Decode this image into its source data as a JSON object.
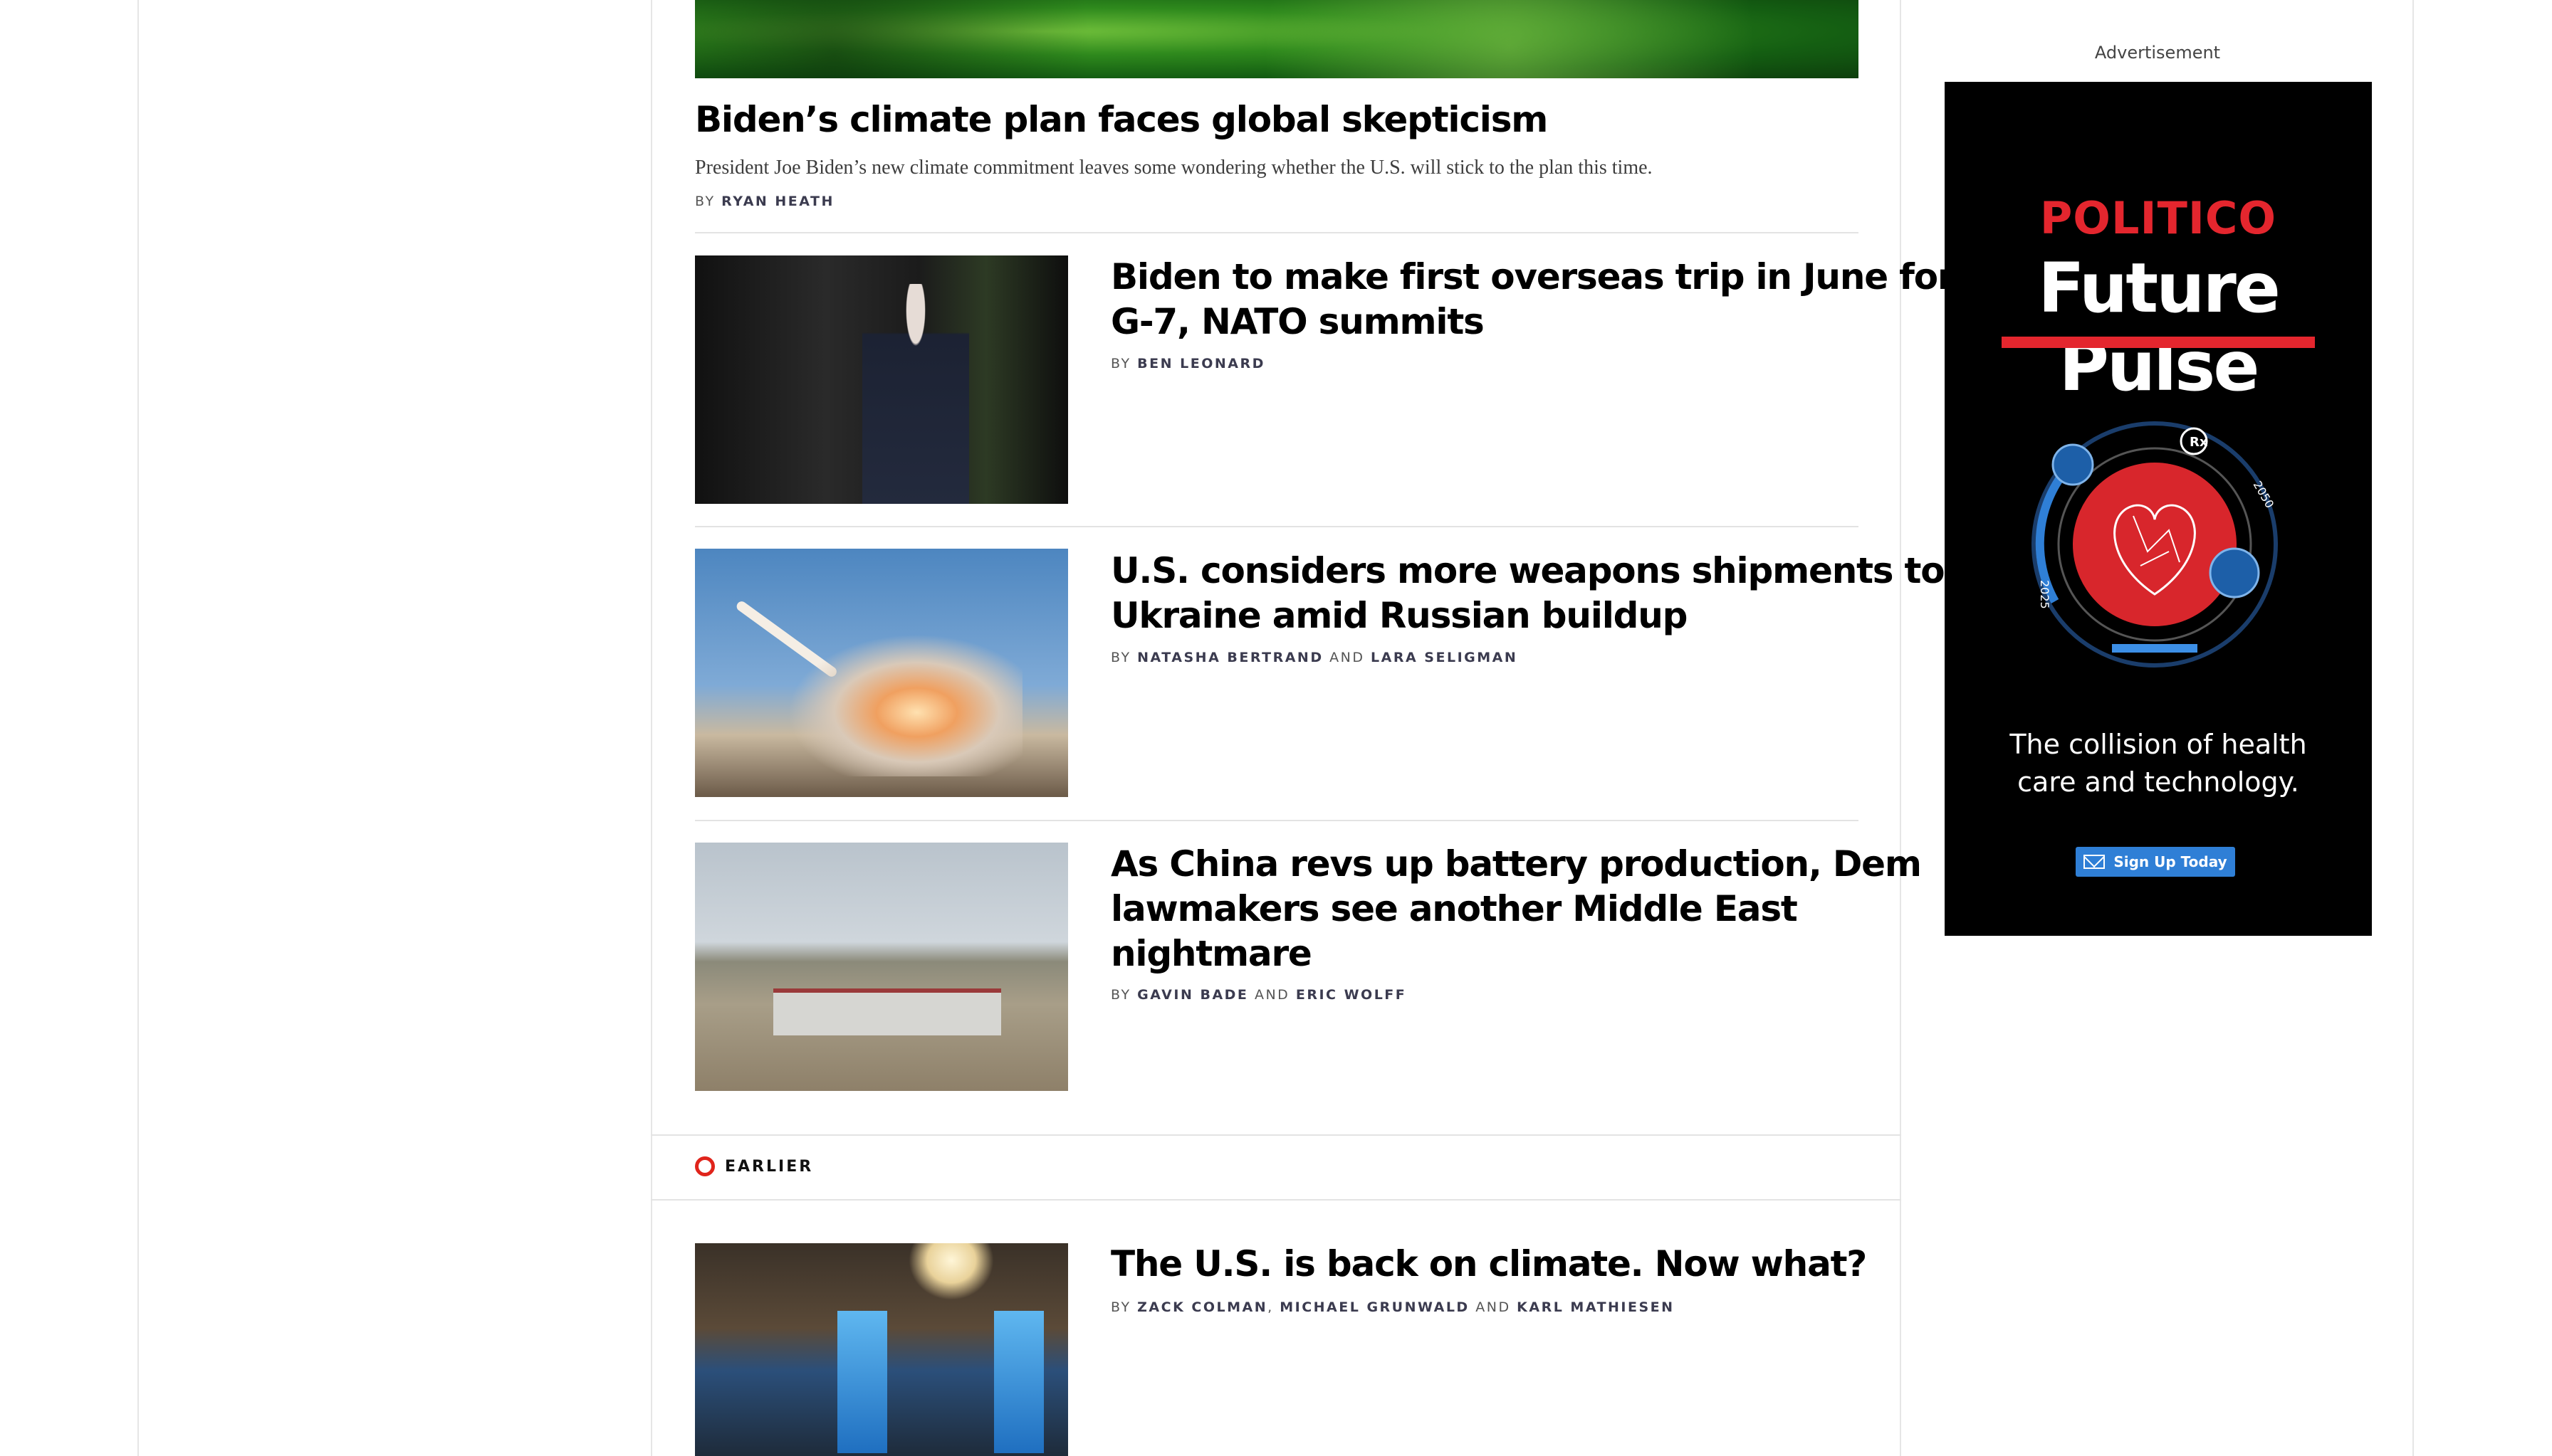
{
  "articles": [
    {
      "headline": "Biden’s climate plan faces global skepticism",
      "dek": "President Joe Biden’s new climate commitment leaves some wondering whether the U.S. will stick to the plan this time.",
      "byline_prefix": "By",
      "authors": [
        "Ryan Heath"
      ]
    },
    {
      "headline_lines": [
        "Biden to make first overseas trip in June for",
        "G-7, NATO summits"
      ],
      "byline_prefix": "By",
      "authors": [
        "Ben Leonard"
      ]
    },
    {
      "headline_lines": [
        "U.S. considers more weapons shipments to",
        "Ukraine amid Russian buildup"
      ],
      "byline_prefix": "By",
      "authors": [
        "Natasha Bertrand",
        "Lara Seligman"
      ],
      "conjunction": "and"
    },
    {
      "headline_lines": [
        "As China revs up battery production, Dem",
        "lawmakers see another Middle East",
        "nightmare"
      ],
      "byline_prefix": "By",
      "authors": [
        "Gavin Bade",
        "Eric Wolff"
      ],
      "conjunction": "and"
    },
    {
      "headline": "The U.S. is back on climate. Now what?",
      "byline_prefix": "By",
      "authors": [
        "Zack Colman",
        "Michael Grunwald",
        "Karl Mathiesen"
      ],
      "separator": ",",
      "conjunction": "and"
    }
  ],
  "section": {
    "earlier_label": "EARLIER",
    "accent_color": "#e0241b"
  },
  "ad": {
    "label": "Advertisement",
    "brand": "POLITICO",
    "title": "Future Pulse",
    "tagline_lines": [
      "The collision of health",
      "care and technology."
    ],
    "button_label": "Sign Up Today",
    "graphic_labels": [
      "2025",
      "2050",
      "Rx"
    ],
    "brand_color": "#e4262e",
    "button_color": "#2f7fd6"
  }
}
